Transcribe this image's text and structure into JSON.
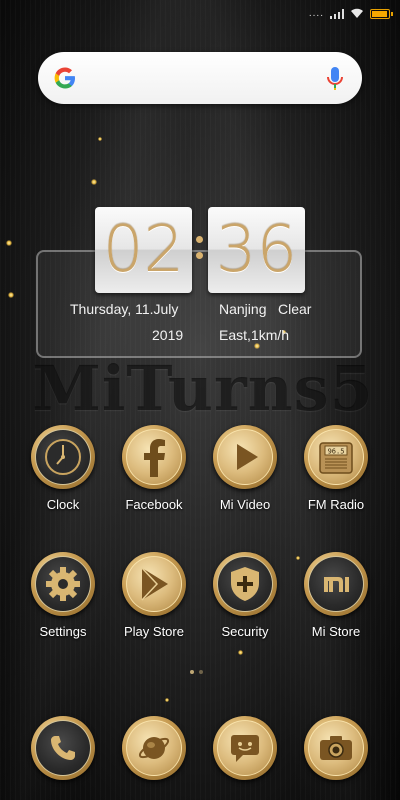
{
  "status_bar": {
    "dots": "....",
    "battery_level": 0.9
  },
  "search": {
    "icon": "google-g-icon",
    "mic_icon": "mic-icon"
  },
  "widget": {
    "hours": "02",
    "minutes": "36",
    "date": "Thursday, 11.July",
    "year": "2019",
    "city": "Nanjing",
    "weather": "Clear",
    "wind": "East,1km/h"
  },
  "watermark": "MiTurns5",
  "apps": [
    {
      "label": "Clock",
      "icon": "clock-icon"
    },
    {
      "label": "Facebook",
      "icon": "facebook-icon"
    },
    {
      "label": "Mi Video",
      "icon": "play-icon"
    },
    {
      "label": "FM Radio",
      "icon": "radio-icon"
    },
    {
      "label": "Settings",
      "icon": "gear-icon"
    },
    {
      "label": "Play Store",
      "icon": "play-store-icon"
    },
    {
      "label": "Security",
      "icon": "shield-icon"
    },
    {
      "label": "Mi Store",
      "icon": "mi-store-icon"
    }
  ],
  "dock": [
    {
      "icon": "phone-icon"
    },
    {
      "icon": "browser-icon"
    },
    {
      "icon": "messages-icon"
    },
    {
      "icon": "camera-icon"
    }
  ],
  "colors": {
    "gold": "#c9a45f",
    "battery": "#f5a800",
    "background": "#1a1a1a"
  },
  "radio_display": "96.5"
}
